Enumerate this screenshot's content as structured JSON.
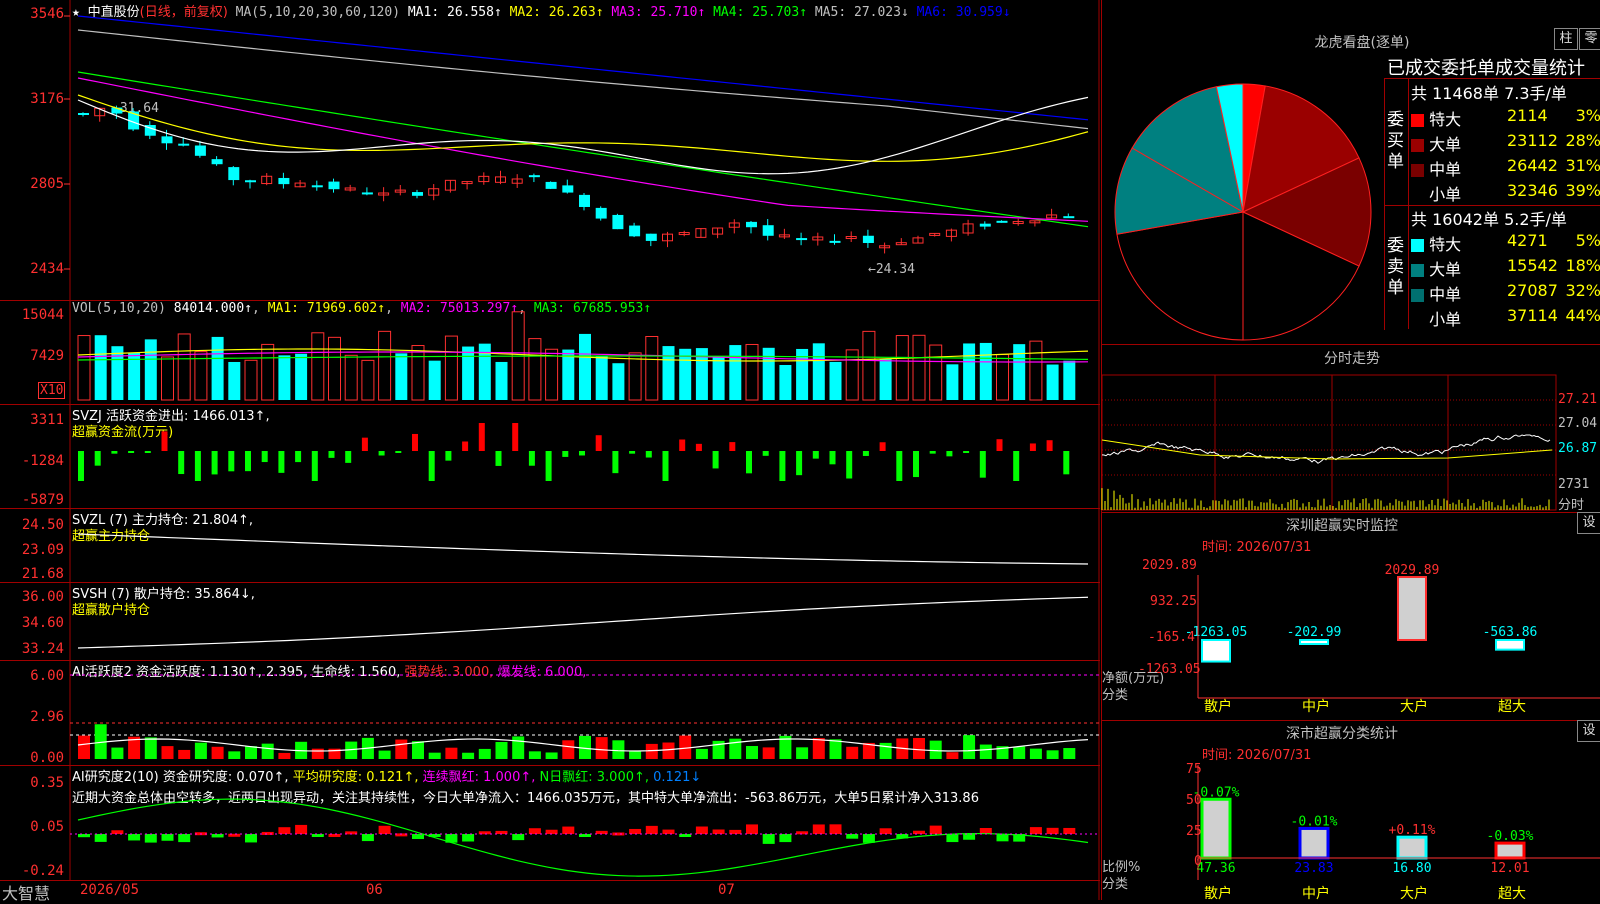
{
  "stock": {
    "name_prefix": "★ ",
    "name": "中直股份",
    "period": "(日线，前复权)"
  },
  "kline": {
    "ma_label": "MA(5,10,20,30,60,120)",
    "ma_values": [
      {
        "label": "MA1: 26.558↑",
        "color": "#ffffff"
      },
      {
        "label": "MA2: 26.263↑",
        "color": "#ffff00"
      },
      {
        "label": "MA3: 25.710↑",
        "color": "#ff00ff"
      },
      {
        "label": "MA4: 25.703↑",
        "color": "#00ff00"
      },
      {
        "label": "MA5: 27.023↓",
        "color": "#c0c0c0"
      },
      {
        "label": "MA6: 30.959↓",
        "color": "#0000ff"
      }
    ],
    "y_ticks": [
      "3546",
      "3176",
      "2805",
      "2434"
    ],
    "high_label": "←31.64",
    "low_label": "←24.34"
  },
  "vol": {
    "title": "VOL(5,10,20)",
    "value": "84014.000↑",
    "ma1": "MA1: 71969.602↑",
    "ma2": "MA2: 75013.297↑",
    "ma3": "MA3: 67685.953↑",
    "y_ticks": [
      "15044",
      "7429"
    ],
    "unit": "X10"
  },
  "svzj": {
    "title": "SVZJ  活跃资金进出: 1466.013↑,",
    "subtitle": "超赢资金流(万元)",
    "y_ticks": [
      "3311",
      "-1284",
      "-5879"
    ]
  },
  "svzl": {
    "title": "SVZL (7) 主力持仓: 21.804↑,",
    "subtitle": "超赢主力持仓",
    "y_ticks": [
      "24.50",
      "23.09",
      "21.68"
    ]
  },
  "svsh": {
    "title": "SVSH (7) 散户持仓: 35.864↓,",
    "subtitle": "超赢散户持仓",
    "y_ticks": [
      "36.00",
      "34.60",
      "33.24"
    ]
  },
  "ai_active": {
    "title": "AI活跃度2 资金活跃度: 1.130↑, 2.395, 生命线: 1.560,",
    "strong": "强势线: 3.000,",
    "burst": "爆发线: 6.000,",
    "y_ticks": [
      "6.00",
      "2.96",
      "0.00"
    ]
  },
  "ai_research": {
    "title": "AI研究度2(10) 资金研究度: 0.070↑,",
    "avg": "平均研究度: 0.121↑,",
    "red": "连续飘红: 1.000↑,",
    "nday": "N日飘红: 3.000↑,",
    "last": "0.121↓",
    "comment": "近期大资金总体由空转多，近两日出现异动，关注其持续性，今日大单净流入：1466.035万元，其中特大单净流出：-563.86万元，大单5日累计净入313.86",
    "y_ticks": [
      "0.35",
      "0.05",
      "-0.24"
    ]
  },
  "xaxis": {
    "brand": "大智慧",
    "dates": [
      "2026/05",
      "06",
      "07"
    ]
  },
  "dragon": {
    "title": "龙虎看盘(逐单)",
    "btn1": "柱",
    "btn2": "零",
    "stat_title": "已成交委托单成交量统计",
    "buy_label": "委买单",
    "sell_label": "委卖单",
    "buy_total": "共 11468单 7.3手/单",
    "sell_total": "共 16042单 5.2手/单",
    "buy": [
      {
        "name": "特大",
        "vol": "2114",
        "pct": "3%",
        "color": "#ff0000"
      },
      {
        "name": "大单",
        "vol": "23112",
        "pct": "28%",
        "color": "#9a0000"
      },
      {
        "name": "中单",
        "vol": "26442",
        "pct": "31%",
        "color": "#7a0000"
      },
      {
        "name": "小单",
        "vol": "32346",
        "pct": "39%",
        "color": "#000000"
      }
    ],
    "sell": [
      {
        "name": "特大",
        "vol": "4271",
        "pct": "5%",
        "color": "#00ffff"
      },
      {
        "name": "大单",
        "vol": "15542",
        "pct": "18%",
        "color": "#008080"
      },
      {
        "name": "中单",
        "vol": "27087",
        "pct": "32%",
        "color": "#007070"
      },
      {
        "name": "小单",
        "vol": "37114",
        "pct": "44%",
        "color": "#000000"
      }
    ]
  },
  "intraday": {
    "title": "分时走势",
    "y_ticks": [
      "27.21",
      "27.04",
      "26.87",
      "2731"
    ],
    "vol_label": "分时"
  },
  "sz_monitor": {
    "title": "深圳超赢实时监控",
    "btn": "设",
    "time": "时间: 2026/07/31",
    "y_ticks": [
      "2029.89",
      "932.25",
      "-165.4",
      "-1263.05"
    ],
    "net_label": "净额(万元)",
    "cat_label": "分类",
    "bars": [
      {
        "name": "散户",
        "value": -1263.05,
        "label": "-1263.05"
      },
      {
        "name": "中户",
        "value": -202.99,
        "label": "-202.99"
      },
      {
        "name": "大户",
        "value": 2029.89,
        "label": "2029.89"
      },
      {
        "name": "超大",
        "value": -563.86,
        "label": "-563.86"
      }
    ]
  },
  "sz_class": {
    "title": "深市超赢分类统计",
    "btn": "设",
    "time": "时间: 2026/07/31",
    "y_ticks": [
      "75",
      "50",
      "25",
      "0"
    ],
    "ratio_label": "比例%",
    "cat_label": "分类",
    "bars": [
      {
        "name": "散户",
        "value": 47.36,
        "label": "47.36",
        "chg": "-0.07%",
        "color": "#00ff00"
      },
      {
        "name": "中户",
        "value": 23.83,
        "label": "23.83",
        "chg": "-0.01%",
        "color": "#0000ff"
      },
      {
        "name": "大户",
        "value": 16.8,
        "label": "16.80",
        "chg": "+0.11%",
        "color": "#00ffff"
      },
      {
        "name": "超大",
        "value": 12.01,
        "label": "12.01",
        "chg": "-0.03%",
        "color": "#ff0000"
      }
    ]
  }
}
